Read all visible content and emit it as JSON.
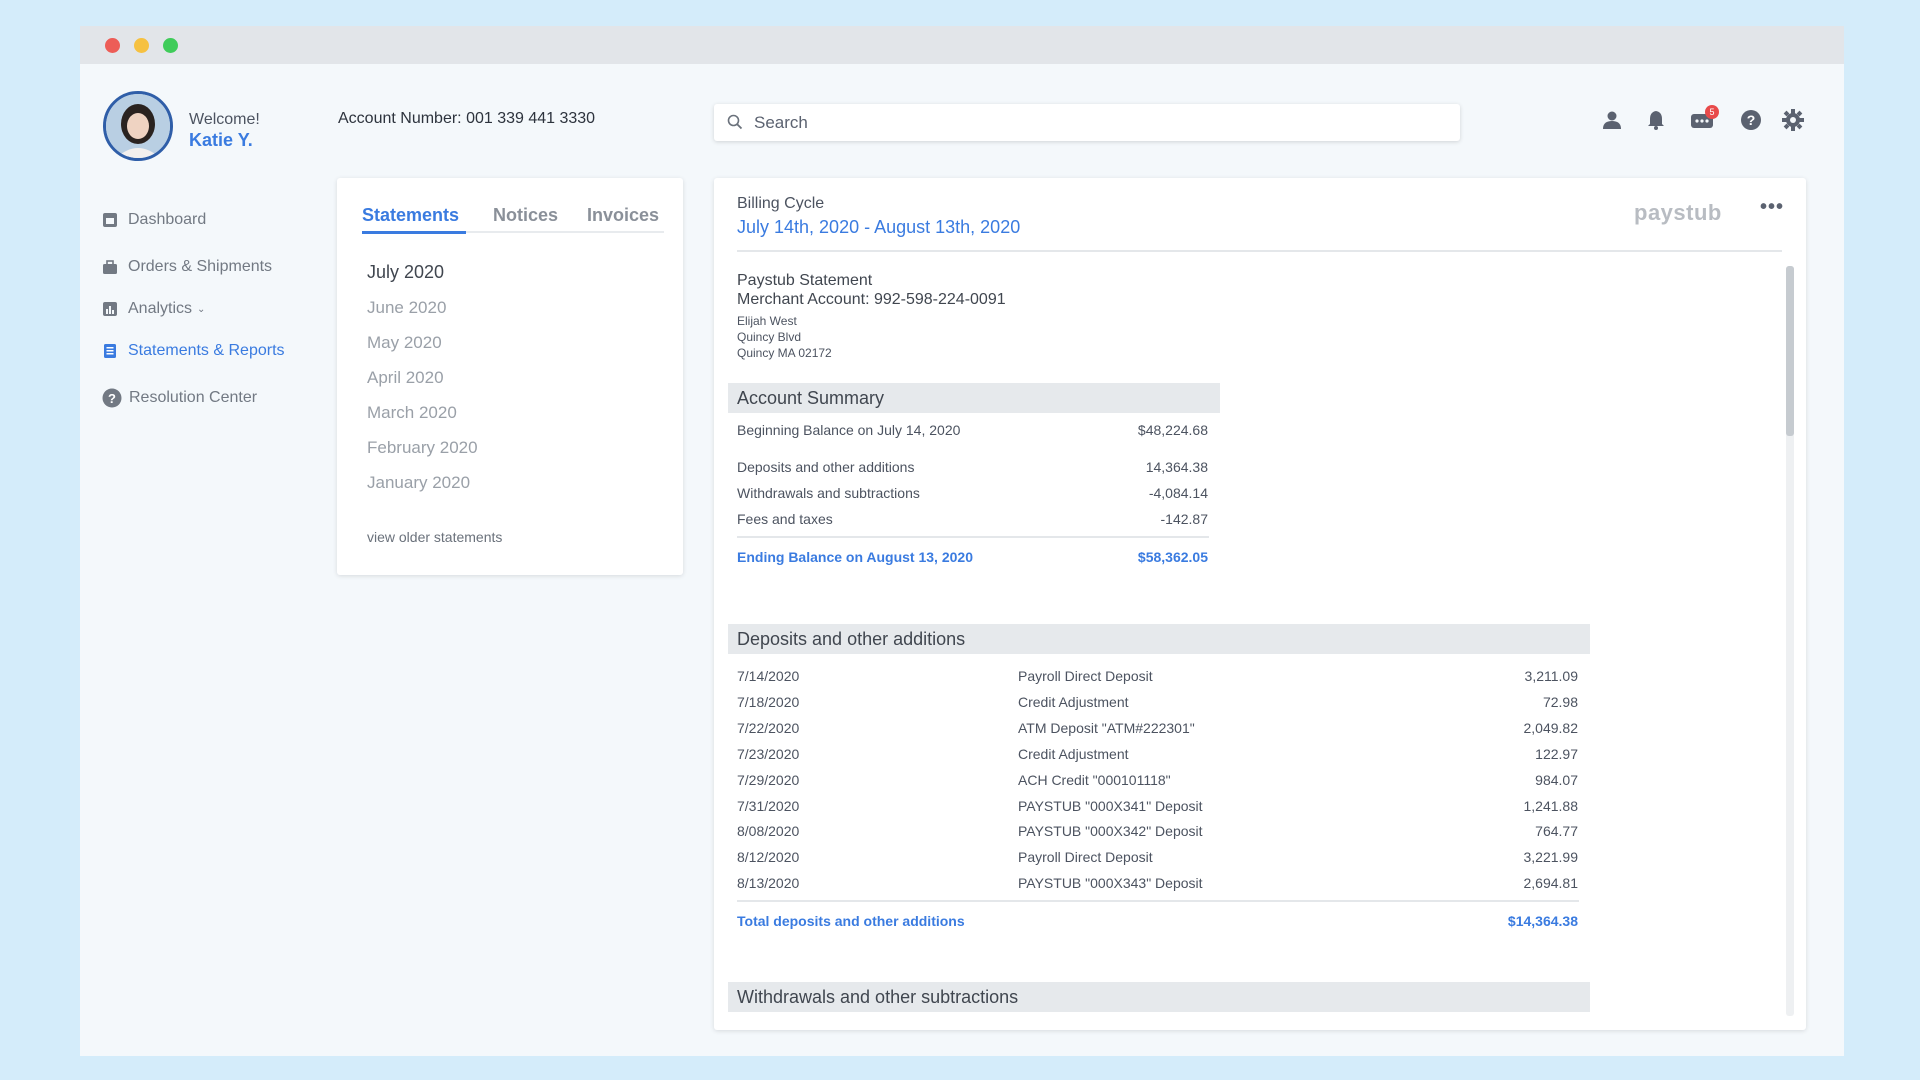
{
  "user": {
    "welcome": "Welcome!",
    "name": "Katie Y."
  },
  "account": {
    "label": "Account Number:",
    "number": "001 339 441 3330"
  },
  "search": {
    "placeholder": "Search"
  },
  "header_icons": {
    "messages_badge": "5"
  },
  "nav": [
    {
      "label": "Dashboard",
      "icon": "dashboard-icon"
    },
    {
      "label": "Orders & Shipments",
      "icon": "briefcase-icon"
    },
    {
      "label": "Analytics",
      "icon": "chart-icon"
    },
    {
      "label": "Statements & Reports",
      "icon": "document-icon"
    },
    {
      "label": "Resolution Center",
      "icon": "help-icon"
    }
  ],
  "tabs": [
    "Statements",
    "Notices",
    "Invoices"
  ],
  "months": [
    "July 2020",
    "June 2020",
    "May 2020",
    "April 2020",
    "March 2020",
    "February 2020",
    "January 2020"
  ],
  "older_link": "view older statements",
  "statement": {
    "billing_cycle_label": "Billing Cycle",
    "billing_cycle_range": "July 14th, 2020 - August 13th, 2020",
    "brand": "paystub",
    "title": "Paystub Statement",
    "merchant": "Merchant Account: 992-598-224-0091",
    "address": [
      "Elijah West",
      "Quincy Blvd",
      "Quincy MA 02172"
    ],
    "summary": {
      "heading": "Account Summary",
      "beginning_label": "Beginning Balance on July 14, 2020",
      "beginning_value": "$48,224.68",
      "rows": [
        {
          "label": "Deposits and other additions",
          "value": "14,364.38"
        },
        {
          "label": "Withdrawals and subtractions",
          "value": "-4,084.14"
        },
        {
          "label": "Fees and taxes",
          "value": "-142.87"
        }
      ],
      "ending_label": "Ending Balance on August 13, 2020",
      "ending_value": "$58,362.05"
    },
    "deposits": {
      "heading": "Deposits and other additions",
      "rows": [
        {
          "date": "7/14/2020",
          "desc": "Payroll Direct Deposit",
          "amount": "3,211.09"
        },
        {
          "date": "7/18/2020",
          "desc": "Credit Adjustment",
          "amount": "72.98"
        },
        {
          "date": "7/22/2020",
          "desc": "ATM Deposit \"ATM#222301\"",
          "amount": "2,049.82"
        },
        {
          "date": "7/23/2020",
          "desc": "Credit Adjustment",
          "amount": "122.97"
        },
        {
          "date": "7/29/2020",
          "desc": "ACH Credit \"000101118\"",
          "amount": "984.07"
        },
        {
          "date": "7/31/2020",
          "desc": "PAYSTUB \"000X341\" Deposit",
          "amount": "1,241.88"
        },
        {
          "date": "8/08/2020",
          "desc": "PAYSTUB \"000X342\" Deposit",
          "amount": "764.77"
        },
        {
          "date": "8/12/2020",
          "desc": "Payroll Direct Deposit",
          "amount": "3,221.99"
        },
        {
          "date": "8/13/2020",
          "desc": "PAYSTUB \"000X343\" Deposit",
          "amount": "2,694.81"
        }
      ],
      "total_label": "Total deposits and other additions",
      "total_value": "$14,364.38"
    },
    "withdrawals": {
      "heading": "Withdrawals and other subtractions"
    }
  },
  "colors": {
    "accent": "#3a7be0",
    "background": "#d4ecfa",
    "badge": "#e84a4a"
  }
}
